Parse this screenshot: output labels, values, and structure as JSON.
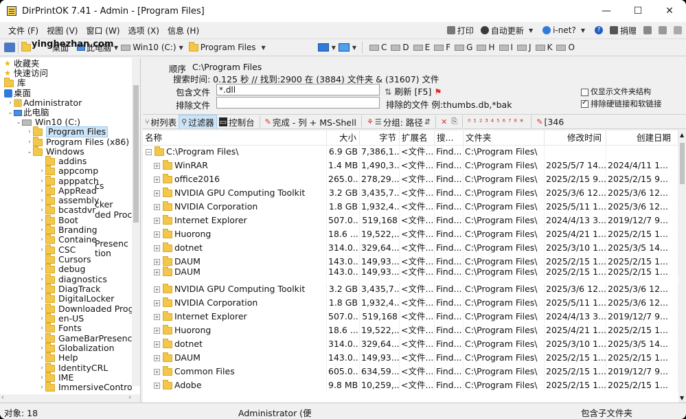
{
  "titlebar": {
    "title": "DirPrintOK 7.41 - Admin - [Program Files]",
    "minimize": "—",
    "maximize": "☐",
    "close": "✕"
  },
  "menubar": {
    "items": [
      "文件 (F)",
      "视图 (V)",
      "窗口 (W)",
      "选项 (X)",
      "信息 (H)"
    ],
    "right": {
      "print": "打印",
      "autoupdate": "自动更新",
      "inet": "i-net?",
      "donate": "捐赠"
    }
  },
  "toolbar": {
    "watermark": "yinghezhan.com",
    "thispc_tail": "此电脑",
    "desktop_tail": "桌面",
    "drive": "Win10 (C:)",
    "folder": "Program Files",
    "drive_letters": [
      "C",
      "D",
      "E",
      "F",
      "G",
      "H",
      "I",
      "J",
      "K",
      "O"
    ]
  },
  "tree": {
    "rows": [
      {
        "label": "收藏夹"
      },
      {
        "label": "快速访问"
      },
      {
        "label": "库"
      },
      {
        "label": "桌面"
      },
      {
        "label": "Administrator"
      },
      {
        "label": "此电脑"
      },
      {
        "label": "Win10 (C:)"
      },
      {
        "label": "Program Files"
      },
      {
        "label": "Program Files (x86)"
      },
      {
        "label": "Windows"
      },
      {
        "label": "addins"
      },
      {
        "label": "appcomp"
      },
      {
        "label": "apppatch"
      },
      {
        "label": "AppRead"
      },
      {
        "label": "assembly"
      },
      {
        "label": "bcastdvr"
      },
      {
        "label": "Boot"
      },
      {
        "label": "Branding"
      },
      {
        "label": "Containe"
      },
      {
        "label": "CSC"
      },
      {
        "label": "Cursors"
      },
      {
        "label": "debug"
      },
      {
        "label": "diagnostics"
      },
      {
        "label": "DiagTrack"
      },
      {
        "label": "DigitalLocker"
      },
      {
        "label": "Downloaded Prog"
      },
      {
        "label": "en-US"
      },
      {
        "label": "Fonts"
      },
      {
        "label": "GameBarPresence"
      },
      {
        "label": "Globalization"
      },
      {
        "label": "Help"
      },
      {
        "label": "IdentityCRL"
      },
      {
        "label": "IME"
      },
      {
        "label": "ImmersiveContro"
      }
    ],
    "overlay": [
      "cs",
      "cker",
      "ded Proc",
      "Presenc",
      "tion"
    ]
  },
  "info": {
    "order_label": "顺序",
    "order_value": "C:\\Program Files",
    "search_line": "搜索时间: 0.125 秒 //  找到:2900 在 (3884) 文件夹 & (31607) 文件",
    "include_label": "包含文件",
    "include_value": "*.dll",
    "refresh_label": "刷新 [F5]",
    "exclude_label": "排除文件",
    "exclude_value": "",
    "excluded_hint": "排除的文件 例:thumbs.db,*bak",
    "only_show_structure": "仅显示文件夹结构",
    "exclude_links": "排除硬链接和软链接"
  },
  "toolbar2": {
    "tree_list": "树列表",
    "filter": "过滤器",
    "console": "控制台",
    "done": "完成 - 列 + MS-Shell",
    "group": "分组: 路径",
    "tail": "[346"
  },
  "list": {
    "headers": [
      "名称",
      "大小",
      "字节",
      "扩展名",
      "搜...",
      "文件夹",
      "修改时间",
      "创建日期"
    ],
    "root": {
      "name": "C:\\Program Files\\",
      "size": "6.9 GB",
      "bytes": "7,386,1...",
      "ext": "<文件...",
      "search": "Find...",
      "folder": "C:\\Program Files\\",
      "mtime": "",
      "ctime": ""
    },
    "rows": [
      {
        "name": "WinRAR",
        "size": "1.4 MB",
        "bytes": "1,490,3...",
        "ext": "<文件...",
        "search": "Find...",
        "folder": "C:\\Program Files\\",
        "mtime": "2025/5/7 14...",
        "ctime": "2024/4/11 1..."
      },
      {
        "name": "office2016",
        "size": "265.0...",
        "bytes": "278,29...",
        "ext": "<文件...",
        "search": "Find...",
        "folder": "C:\\Program Files\\",
        "mtime": "2025/2/15 9...",
        "ctime": "2025/2/15 9..."
      },
      {
        "name": "NVIDIA GPU Computing Toolkit",
        "size": "3.2 GB",
        "bytes": "3,435,7...",
        "ext": "<文件...",
        "search": "Find...",
        "folder": "C:\\Program Files\\",
        "mtime": "2025/3/6 12...",
        "ctime": "2025/3/6 12..."
      },
      {
        "name": "NVIDIA Corporation",
        "size": "1.8 GB",
        "bytes": "1,932,4...",
        "ext": "<文件...",
        "search": "Find...",
        "folder": "C:\\Program Files\\",
        "mtime": "2025/5/11 1...",
        "ctime": "2025/3/6 12..."
      },
      {
        "name": "Internet Explorer",
        "size": "507.0...",
        "bytes": "519,168",
        "ext": "<文件...",
        "search": "Find...",
        "folder": "C:\\Program Files\\",
        "mtime": "2024/4/13 3...",
        "ctime": "2019/12/7 9..."
      },
      {
        "name": "Huorong",
        "size": "18.6 ...",
        "bytes": "19,522,...",
        "ext": "<文件...",
        "search": "Find...",
        "folder": "C:\\Program Files\\",
        "mtime": "2025/4/21 1...",
        "ctime": "2025/2/15 1..."
      },
      {
        "name": "dotnet",
        "size": "314.0...",
        "bytes": "329,64...",
        "ext": "<文件...",
        "search": "Find...",
        "folder": "C:\\Program Files\\",
        "mtime": "2025/3/10 1...",
        "ctime": "2025/3/5 14..."
      },
      {
        "name": "DAUM",
        "size": "143.0...",
        "bytes": "149,93...",
        "ext": "<文件...",
        "search": "Find...",
        "folder": "C:\\Program Files\\",
        "mtime": "2025/2/15 1...",
        "ctime": "2025/2/15 1..."
      },
      {
        "name": "DAUM",
        "size": "143.0...",
        "bytes": "149,93...",
        "ext": "<文件...",
        "search": "Find...",
        "folder": "C:\\Program Files\\",
        "mtime": "2025/2/15 1...",
        "ctime": "2025/2/15 1..."
      },
      {
        "name": "NVIDIA GPU Computing Toolkit",
        "size": "3.2 GB",
        "bytes": "3,435,7...",
        "ext": "<文件...",
        "search": "Find...",
        "folder": "C:\\Program Files\\",
        "mtime": "2025/3/6 12...",
        "ctime": "2025/3/6 12..."
      },
      {
        "name": "NVIDIA Corporation",
        "size": "1.8 GB",
        "bytes": "1,932,4...",
        "ext": "<文件...",
        "search": "Find...",
        "folder": "C:\\Program Files\\",
        "mtime": "2025/5/11 1...",
        "ctime": "2025/3/6 12..."
      },
      {
        "name": "Internet Explorer",
        "size": "507.0...",
        "bytes": "519,168",
        "ext": "<文件...",
        "search": "Find...",
        "folder": "C:\\Program Files\\",
        "mtime": "2024/4/13 3...",
        "ctime": "2019/12/7 9..."
      },
      {
        "name": "Huorong",
        "size": "18.6 ...",
        "bytes": "19,522,...",
        "ext": "<文件...",
        "search": "Find...",
        "folder": "C:\\Program Files\\",
        "mtime": "2025/4/21 1...",
        "ctime": "2025/2/15 1..."
      },
      {
        "name": "dotnet",
        "size": "314.0...",
        "bytes": "329,64...",
        "ext": "<文件...",
        "search": "Find...",
        "folder": "C:\\Program Files\\",
        "mtime": "2025/3/10 1...",
        "ctime": "2025/3/5 14..."
      },
      {
        "name": "DAUM",
        "size": "143.0...",
        "bytes": "149,93...",
        "ext": "<文件...",
        "search": "Find...",
        "folder": "C:\\Program Files\\",
        "mtime": "2025/2/15 1...",
        "ctime": "2025/2/15 1..."
      },
      {
        "name": "Common Files",
        "size": "605.0...",
        "bytes": "634,59...",
        "ext": "<文件...",
        "search": "Find...",
        "folder": "C:\\Program Files\\",
        "mtime": "2025/2/15 1...",
        "ctime": "2019/12/7 9..."
      },
      {
        "name": "Adobe",
        "size": "9.8 MB",
        "bytes": "10,259,...",
        "ext": "<文件...",
        "search": "Find...",
        "folder": "C:\\Program Files\\",
        "mtime": "2025/2/15 1...",
        "ctime": "2025/2/15 1..."
      }
    ]
  },
  "status": {
    "objects": "对象: 18",
    "user": "Administrator (便",
    "include_sub": "包含子文件夹"
  },
  "colors": {
    "selection": "#cce4f7",
    "folder": "#f3c74a",
    "accent_red": "#d9302c"
  }
}
